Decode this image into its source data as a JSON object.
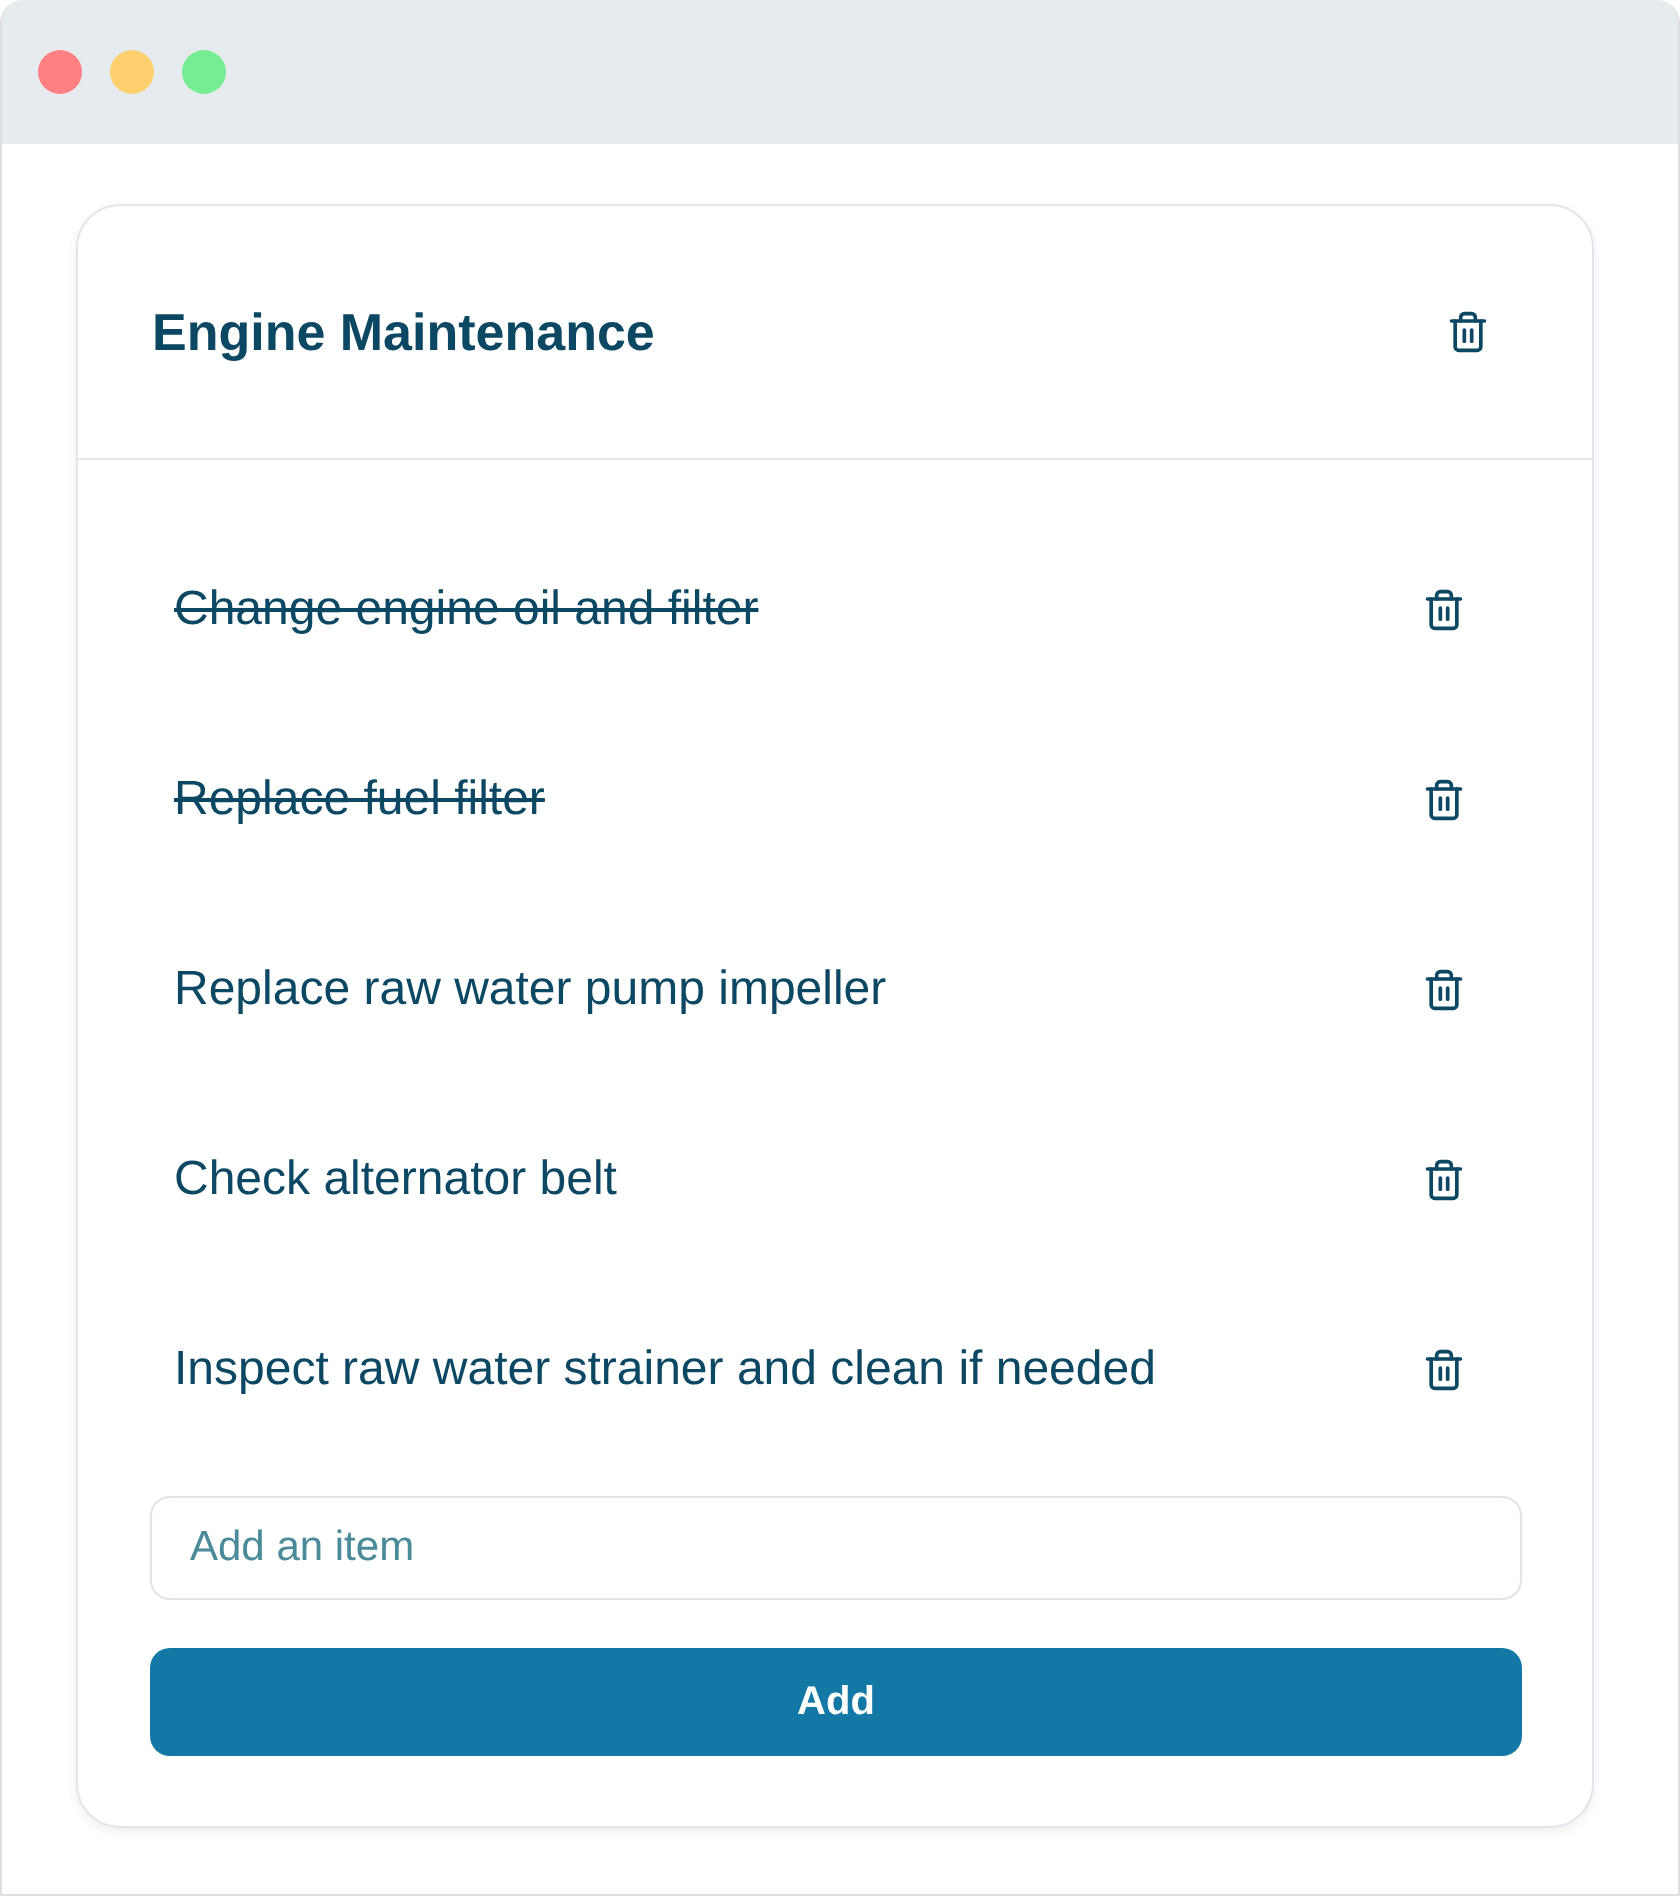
{
  "window": {
    "controls": [
      {
        "color": "#fe8080"
      },
      {
        "color": "#fed06e"
      },
      {
        "color": "#77ec94"
      }
    ]
  },
  "checklist": {
    "title": "Engine Maintenance",
    "items": [
      {
        "text": "Change engine oil and filter",
        "completed": true
      },
      {
        "text": "Replace fuel filter",
        "completed": true
      },
      {
        "text": "Replace raw water pump impeller",
        "completed": false
      },
      {
        "text": "Check alternator belt",
        "completed": false
      },
      {
        "text": "Inspect raw water strainer and clean if needed",
        "completed": false
      }
    ],
    "new_item": {
      "placeholder": "Add an item"
    },
    "add_button": {
      "label": "Add"
    }
  }
}
